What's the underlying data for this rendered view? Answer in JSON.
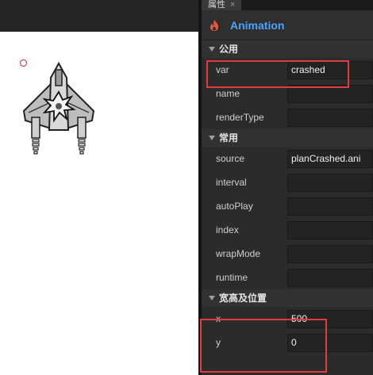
{
  "tab": {
    "label": "属性",
    "close": "×"
  },
  "panel": {
    "title": "Animation"
  },
  "sections": [
    {
      "title": "公用",
      "rows": [
        {
          "label": "var",
          "value": "crashed"
        },
        {
          "label": "name",
          "value": ""
        },
        {
          "label": "renderType",
          "value": ""
        }
      ]
    },
    {
      "title": "常用",
      "rows": [
        {
          "label": "source",
          "value": "planCrashed.ani"
        },
        {
          "label": "interval",
          "value": ""
        },
        {
          "label": "autoPlay",
          "value": ""
        },
        {
          "label": "index",
          "value": ""
        },
        {
          "label": "wrapMode",
          "value": ""
        },
        {
          "label": "runtime",
          "value": ""
        }
      ]
    },
    {
      "title": "宽高及位置",
      "rows": [
        {
          "label": "x",
          "value": "500"
        },
        {
          "label": "y",
          "value": "0"
        }
      ]
    }
  ],
  "colors": {
    "highlight": "#e03c3c",
    "title": "#4aa3ff"
  },
  "icons": {
    "header": "flame-icon",
    "section_toggle": "triangle-down-icon"
  }
}
